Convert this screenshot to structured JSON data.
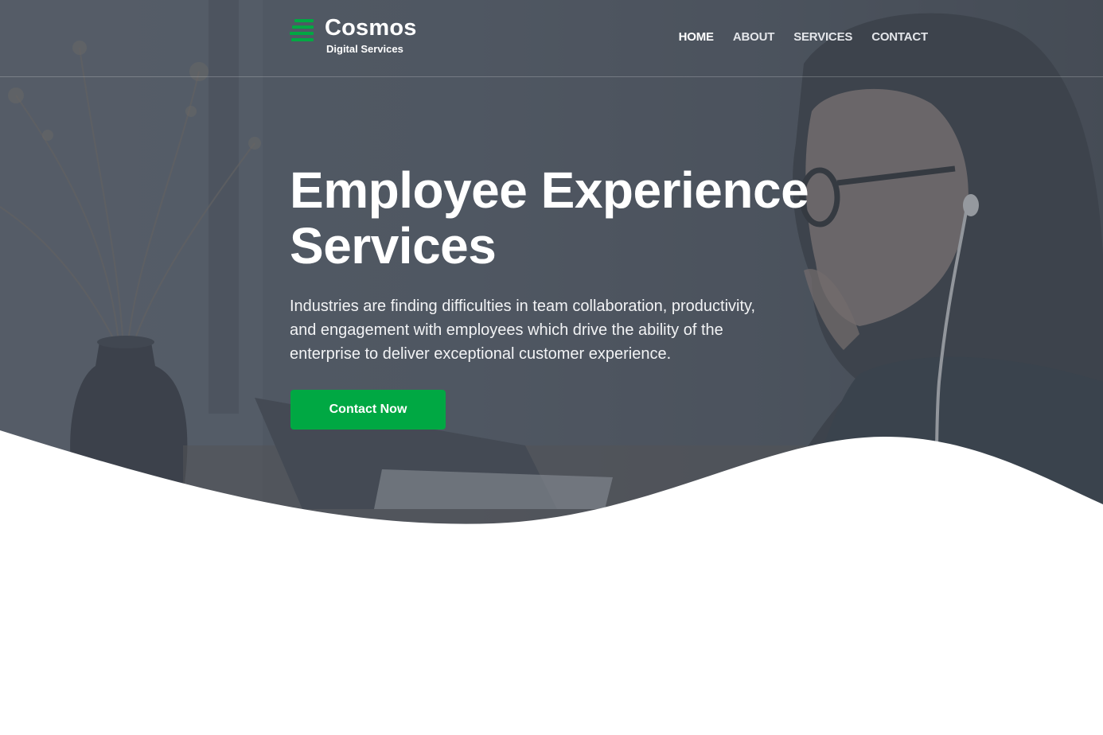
{
  "brand": {
    "title": "Cosmos",
    "subtitle": "Digital Services",
    "icon": "stacked-bars-logo-icon",
    "accent_color": "#00a843"
  },
  "nav": {
    "items": [
      {
        "label": "HOME",
        "active": true
      },
      {
        "label": "ABOUT",
        "active": false
      },
      {
        "label": "SERVICES",
        "active": false
      },
      {
        "label": "CONTACT",
        "active": false
      }
    ]
  },
  "hero": {
    "headline": "Employee Experience Services",
    "description": "Industries are finding difficulties in team collaboration, productivity, and engagement with employees which drive the ability of the enterprise to deliver exceptional customer experience.",
    "cta_label": "Contact Now",
    "cta_color": "#00a843"
  }
}
